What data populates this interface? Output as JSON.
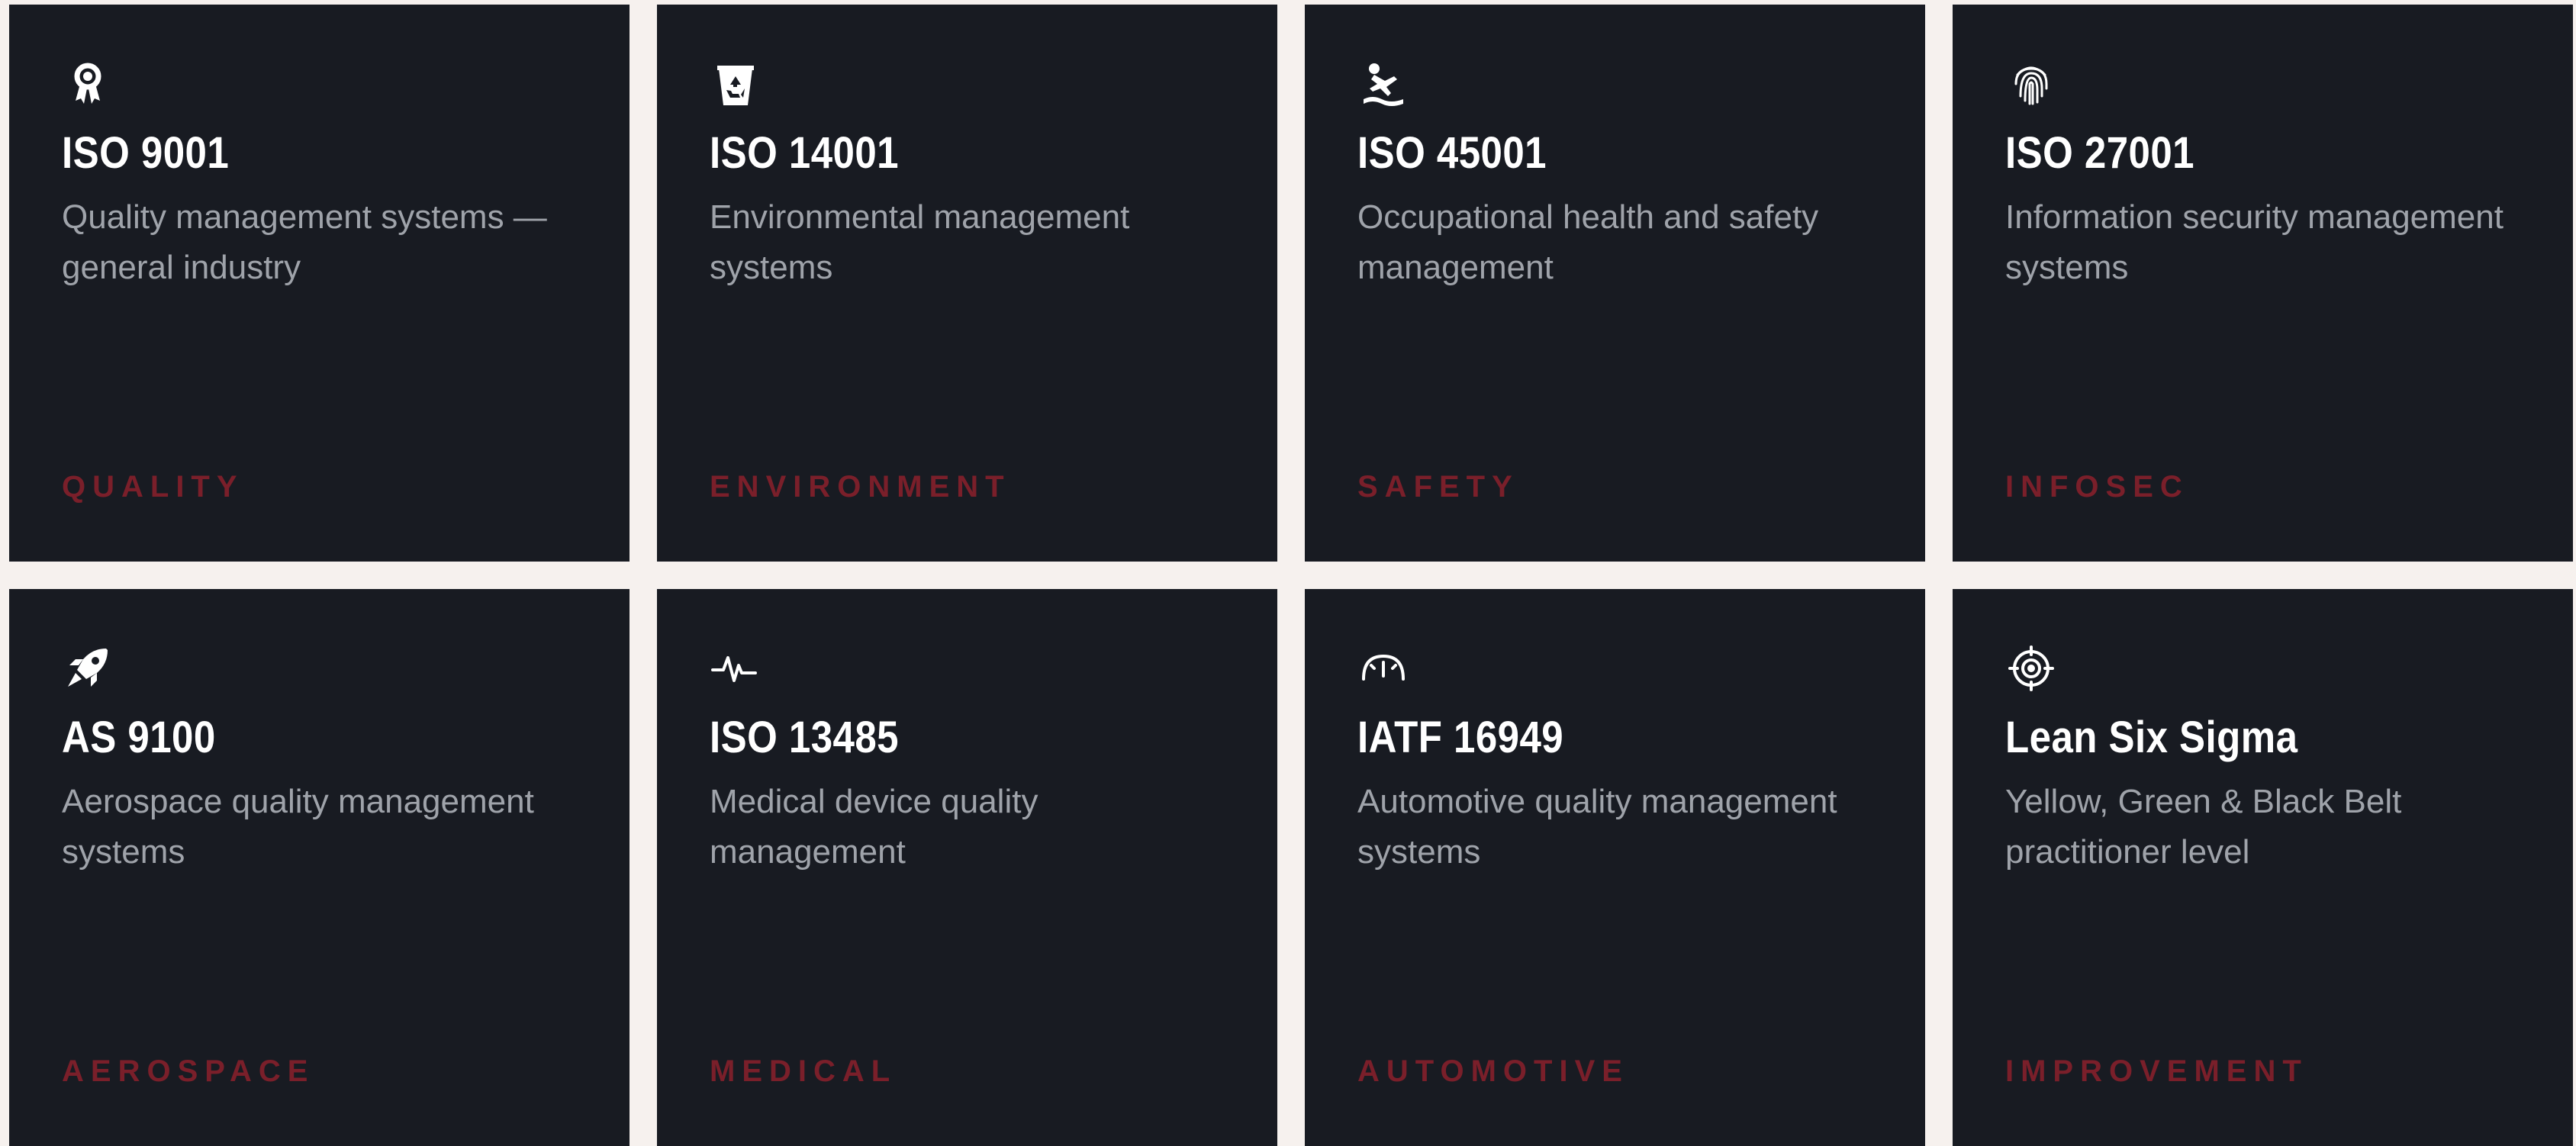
{
  "colors": {
    "page_background": "#f6f1ee",
    "card_background": "#181b22",
    "title": "#ffffff",
    "description": "#9fa3aa",
    "tag": "#7a1f2a",
    "icon": "#ffffff"
  },
  "cards": [
    {
      "icon": "award-ribbon-icon",
      "title": "ISO 9001",
      "description": "Quality management systems — general industry",
      "tag": "QUALITY"
    },
    {
      "icon": "recycle-bin-icon",
      "title": "ISO 14001",
      "description": "Environmental management systems",
      "tag": "ENVIRONMENT"
    },
    {
      "icon": "person-slipping-icon",
      "title": "ISO 45001",
      "description": "Occupational health and safety management",
      "tag": "SAFETY"
    },
    {
      "icon": "fingerprint-icon",
      "title": "ISO 27001",
      "description": "Information security management systems",
      "tag": "INFOSEC"
    },
    {
      "icon": "rocket-icon",
      "title": "AS 9100",
      "description": "Aerospace quality management systems",
      "tag": "AEROSPACE"
    },
    {
      "icon": "heartbeat-icon",
      "title": "ISO 13485",
      "description": "Medical device quality management",
      "tag": "MEDICAL"
    },
    {
      "icon": "gauge-icon",
      "title": "IATF 16949",
      "description": "Automotive quality management systems",
      "tag": "AUTOMOTIVE"
    },
    {
      "icon": "crosshair-target-icon",
      "title": "Lean Six Sigma",
      "description": "Yellow, Green & Black Belt practitioner level",
      "tag": "IMPROVEMENT"
    }
  ]
}
